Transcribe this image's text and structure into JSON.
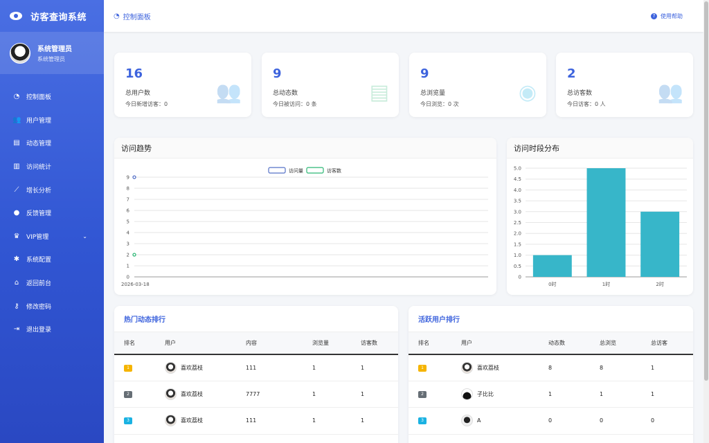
{
  "brand": {
    "title": "访客查询系统"
  },
  "user": {
    "name": "系统管理员",
    "role": "系统管理员"
  },
  "nav": [
    {
      "label": "控制面板",
      "icon": "dashboard-icon",
      "glyph": "◔"
    },
    {
      "label": "用户管理",
      "icon": "users-icon",
      "glyph": "👥"
    },
    {
      "label": "动态管理",
      "icon": "file-icon",
      "glyph": "▤"
    },
    {
      "label": "访问统计",
      "icon": "bar-chart-icon",
      "glyph": "▥"
    },
    {
      "label": "增长分析",
      "icon": "line-chart-icon",
      "glyph": "⟋"
    },
    {
      "label": "反馈管理",
      "icon": "comments-icon",
      "glyph": "●"
    },
    {
      "label": "VIP管理",
      "icon": "crown-icon",
      "glyph": "♛"
    },
    {
      "label": "系统配置",
      "icon": "gear-icon",
      "glyph": "✱"
    },
    {
      "label": "返回前台",
      "icon": "home-icon",
      "glyph": "⌂"
    },
    {
      "label": "修改密码",
      "icon": "key-icon",
      "glyph": "⚷"
    },
    {
      "label": "退出登录",
      "icon": "logout-icon",
      "glyph": "⇥"
    }
  ],
  "header": {
    "breadcrumb": "控制面板",
    "help": "使用帮助"
  },
  "stats": [
    {
      "value": "16",
      "label": "总用户数",
      "sub": "今日新增访客：0",
      "icon": "users-icon",
      "color": "#3d63dd"
    },
    {
      "value": "9",
      "label": "总动态数",
      "sub": "今日被访问：0 条",
      "icon": "file-icon",
      "color": "#2bb673"
    },
    {
      "value": "9",
      "label": "总浏览量",
      "sub": "今日浏览：0 次",
      "icon": "eye-icon",
      "color": "#1ab2e2"
    },
    {
      "value": "2",
      "label": "总访客数",
      "sub": "今日访客：0 人",
      "icon": "user-group-icon",
      "color": "#f5b400"
    }
  ],
  "trend_panel": {
    "title": "访问趋势"
  },
  "hour_panel": {
    "title": "访问时段分布"
  },
  "chart_data": [
    {
      "type": "line",
      "title": "访问趋势",
      "x": [
        "2026-03-18"
      ],
      "series": [
        {
          "name": "访问量",
          "values": [
            9
          ],
          "color": "#5470c6"
        },
        {
          "name": "访客数",
          "values": [
            2
          ],
          "color": "#2bb673"
        }
      ],
      "ylim": [
        0,
        9
      ],
      "yticks": [
        "0",
        "1",
        "2",
        "3",
        "4",
        "5",
        "6",
        "7",
        "8",
        "9"
      ],
      "legend": "top-center",
      "grid": true
    },
    {
      "type": "bar",
      "title": "访问时段分布",
      "categories": [
        "0时",
        "1时",
        "2时"
      ],
      "values": [
        1,
        5,
        3
      ],
      "color": "#37b6c9",
      "ylim": [
        0,
        5
      ],
      "yticks": [
        "0",
        "0.5",
        "1.0",
        "1.5",
        "2.0",
        "2.5",
        "3.0",
        "3.5",
        "4.0",
        "4.5",
        "5.0"
      ],
      "grid": true
    }
  ],
  "hot_posts": {
    "title": "热门动态排行",
    "headers": [
      "排名",
      "用户",
      "内容",
      "浏览量",
      "访客数"
    ],
    "rows": [
      {
        "rank": "1",
        "user": "喜欢荔枝",
        "content": "111",
        "views": "1",
        "visitors": "1"
      },
      {
        "rank": "2",
        "user": "喜欢荔枝",
        "content": "7777",
        "views": "1",
        "visitors": "1"
      },
      {
        "rank": "3",
        "user": "喜欢荔枝",
        "content": "111",
        "views": "1",
        "visitors": "1"
      }
    ]
  },
  "active_users": {
    "title": "活跃用户排行",
    "headers": [
      "排名",
      "用户",
      "动态数",
      "总浏览",
      "总访客"
    ],
    "rows": [
      {
        "rank": "1",
        "user": "喜欢荔枝",
        "posts": "8",
        "views": "8",
        "visitors": "1"
      },
      {
        "rank": "2",
        "user": "子比比",
        "posts": "1",
        "views": "1",
        "visitors": "1"
      },
      {
        "rank": "3",
        "user": "A",
        "posts": "0",
        "views": "0",
        "visitors": "0"
      }
    ]
  }
}
